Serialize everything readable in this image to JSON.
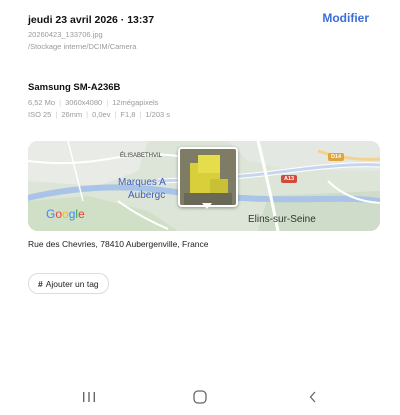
{
  "header": {
    "datetime": "jeudi 23 avril 2026 · 13:37",
    "edit_label": "Modifier",
    "filename": "20260423_133706.jpg",
    "path": "/Stockage interne/DCIM/Camera"
  },
  "camera": {
    "device": "Samsung SM-A236B",
    "filesize": "6,52 Mo",
    "resolution": "3060x4080",
    "megapixels": "12mégapixels",
    "iso": "ISO 25",
    "focal": "26mm",
    "ev": "0,0ev",
    "aperture": "F1,8",
    "shutter": "1/203 s"
  },
  "map": {
    "label_elisabeth": "ÉLISABETHVIL",
    "label_marques": "Marques A",
    "label_aubergenville": "Aubergc",
    "label_elins": "Elins-sur-Seine",
    "road_d14": "D14",
    "road_a13": "A13",
    "google_logo": "Google"
  },
  "location": {
    "address": "Rue des Chevries, 78410 Aubergenville, France"
  },
  "tags": {
    "add_label": "Ajouter un tag",
    "hash": "#"
  },
  "icons": {
    "recent": "recent-apps-icon",
    "home": "home-icon",
    "back": "back-icon"
  },
  "colors": {
    "accent": "#3a6fd8",
    "secondary_text": "#9a9a9a"
  }
}
